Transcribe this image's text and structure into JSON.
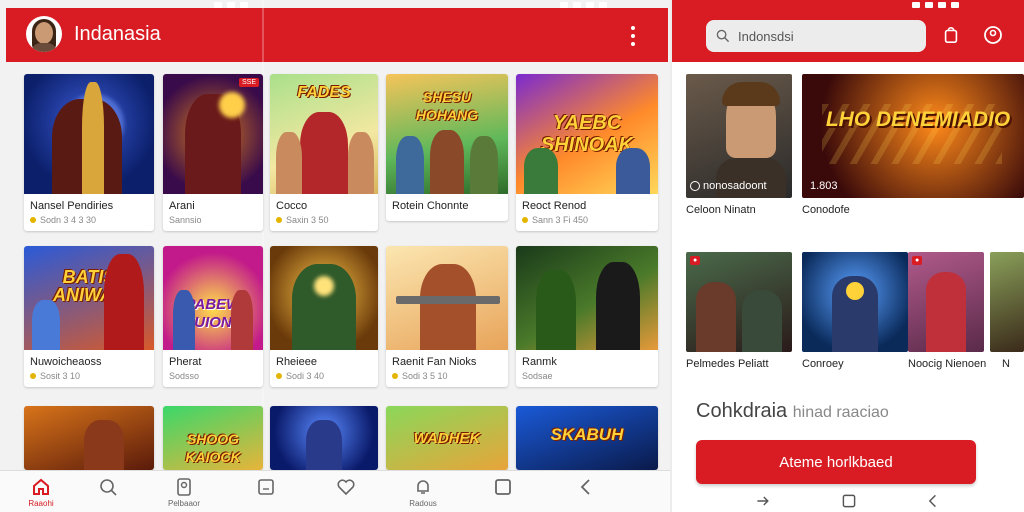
{
  "colors": {
    "brand_red": "#d91c23",
    "background": "#f2f2f2",
    "text": "#222222",
    "muted": "#888888"
  },
  "left_app": {
    "title": "Indanasia",
    "games": [
      {
        "name": "Nansel Pendiries",
        "meta": "Sodn 3 4 3 30",
        "logo": ""
      },
      {
        "name": "Arani",
        "meta": "Sannsio",
        "logo": "",
        "badge": "SSE"
      },
      {
        "name": "Cocco",
        "meta": "Saxin 3 50",
        "logo": "FADES"
      },
      {
        "name": "Rotein Chonnte",
        "meta": "",
        "logo": "SHESU HOHANG"
      },
      {
        "name": "Reoct Renod",
        "meta": "Sann 3 Fi 450",
        "logo": "YAEBC SHINOAK"
      },
      {
        "name": "Nuwoicheaoss",
        "meta": "Sosit 3 10",
        "logo": "BATIS ANIWAS"
      },
      {
        "name": "Pherat",
        "meta": "Sodsso",
        "logo": "PABEW NUIONA"
      },
      {
        "name": "Rheieee",
        "meta": "Sodi 3 40",
        "logo": ""
      },
      {
        "name": "Raenit Fan Nioks",
        "meta": "Sodi 3 5 10",
        "logo": ""
      },
      {
        "name": "Ranmk",
        "meta": "Sodsae",
        "logo": ""
      },
      {
        "name": "",
        "meta": "",
        "logo": ""
      },
      {
        "name": "",
        "meta": "",
        "logo": "SHOOG KAIOCK"
      },
      {
        "name": "",
        "meta": "",
        "logo": ""
      },
      {
        "name": "",
        "meta": "",
        "logo": "WADHEK"
      },
      {
        "name": "",
        "meta": "",
        "logo": "SKABUH"
      }
    ],
    "nav": [
      {
        "label": "Raaohi",
        "icon": "home-icon"
      },
      {
        "label": "",
        "icon": "search-icon"
      },
      {
        "label": "Pelbaaor",
        "icon": "profile-icon"
      },
      {
        "label": "",
        "icon": "tablet-icon"
      },
      {
        "label": "",
        "icon": "heart-icon"
      },
      {
        "label": "Radous",
        "icon": "bell-icon"
      },
      {
        "label": "",
        "icon": "square-icon"
      },
      {
        "label": "",
        "icon": "back-icon"
      }
    ]
  },
  "right_app": {
    "search_value": "Indonsdsi",
    "featured": [
      {
        "label": "Celoon Ninatn",
        "overlay": "nonosadoont",
        "logo": ""
      },
      {
        "label": "Conodofe",
        "overlay": "1.803",
        "logo": "LHO DENEMIADIO"
      }
    ],
    "minis": [
      {
        "label": "Pelmedes Peliatt"
      },
      {
        "label": "Conroey"
      },
      {
        "label": "Noocig Nienoen"
      },
      {
        "label": "N"
      }
    ],
    "section_title": "Cohkdraia",
    "section_sub": "hinad raaciao",
    "cta": "Ateme horlkbaed"
  }
}
